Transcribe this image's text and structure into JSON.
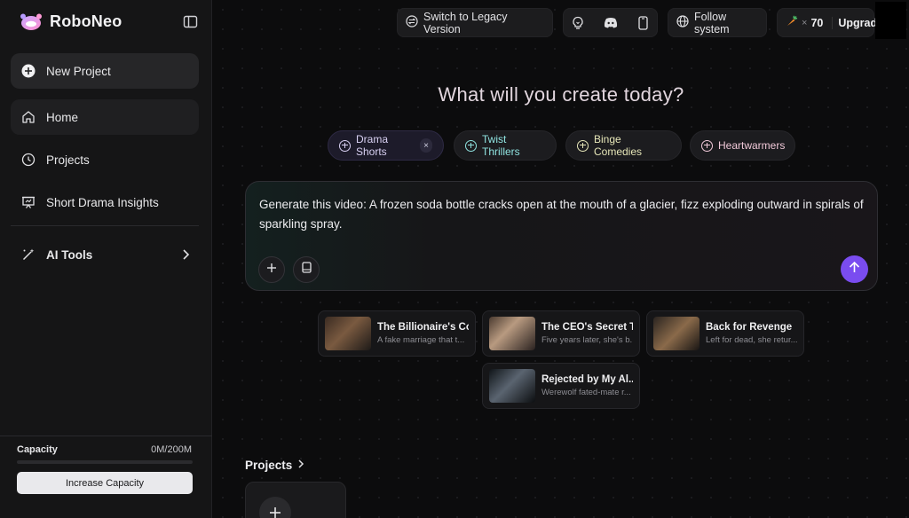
{
  "app": {
    "name": "RoboNeo"
  },
  "sidebar": {
    "items": [
      {
        "label": "New Project",
        "icon": "plus-circle-icon"
      },
      {
        "label": "Home",
        "icon": "home-icon"
      },
      {
        "label": "Projects",
        "icon": "clock-icon"
      },
      {
        "label": "Short Drama Insights",
        "icon": "presentation-chart-icon"
      }
    ],
    "ai_tools": {
      "label": "AI Tools",
      "icon": "magic-wand-icon"
    },
    "capacity": {
      "label": "Capacity",
      "value": "0M/200M",
      "fraction": 0.0,
      "button": "Increase Capacity"
    }
  },
  "topbar": {
    "legacy": "Switch to Legacy Version",
    "theme": "Follow system",
    "credits": {
      "multiplier": "×",
      "count": "70",
      "upgrade": "Upgrade"
    }
  },
  "main": {
    "headline": "What will you create today?",
    "chips": [
      {
        "label": "Drama Shorts",
        "selected": true,
        "close": "×"
      },
      {
        "label": "Twist Thrillers"
      },
      {
        "label": "Binge Comedies"
      },
      {
        "label": "Heartwarmers"
      }
    ],
    "prompt": "Generate this video: A frozen soda bottle cracks open at the mouth of a glacier, fizz exploding outward in spirals of sparkling spray.",
    "templates": [
      {
        "title": "The Billionaire's Co...",
        "subtitle": "A fake marriage that t..."
      },
      {
        "title": "The CEO's Secret T...",
        "subtitle": "Five years later, she's b..."
      },
      {
        "title": "Back for Revenge",
        "subtitle": "Left for dead, she retur..."
      },
      {
        "title": "Rejected by My Al...",
        "subtitle": "Werewolf fated-mate r..."
      }
    ],
    "projects_heading": "Projects"
  },
  "colors": {
    "accent": "#7a4cf0",
    "teal": "#8fe3e0"
  }
}
